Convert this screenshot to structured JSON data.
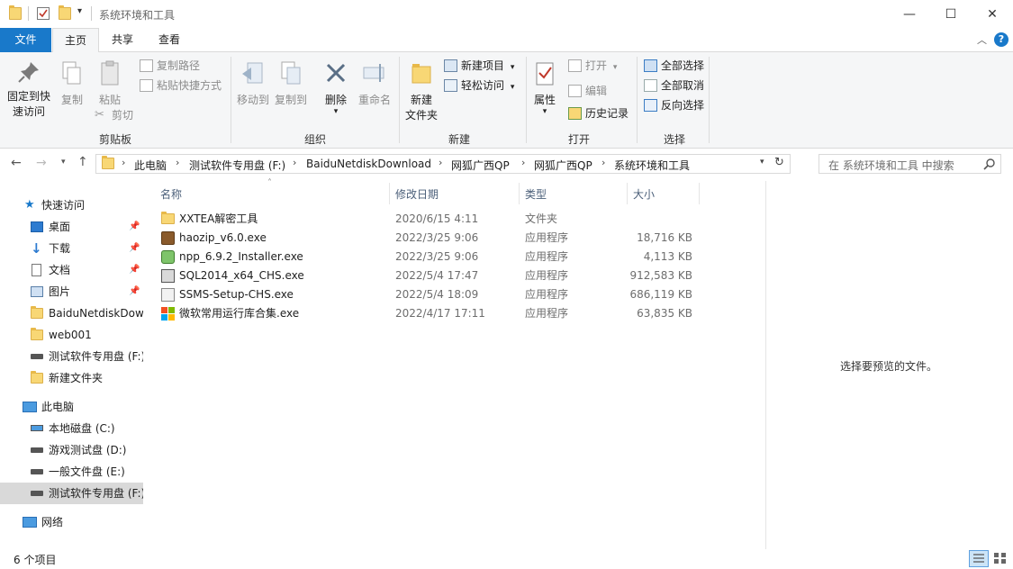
{
  "window": {
    "title": "系统环境和工具",
    "minimize_glyph": "—",
    "maximize_glyph": "☐",
    "close_glyph": "✕"
  },
  "tabs": {
    "file": "文件",
    "home": "主页",
    "share": "共享",
    "view": "查看"
  },
  "ribbon": {
    "clipboard": {
      "label": "剪贴板",
      "pin": "固定到快速访问",
      "pin_line1": "固定到快",
      "pin_line2": "速访问",
      "copy": "复制",
      "paste": "粘贴",
      "copy_path": "复制路径",
      "paste_shortcut": "粘贴快捷方式",
      "cut": "剪切"
    },
    "organize": {
      "label": "组织",
      "move_to": "移动到",
      "copy_to": "复制到",
      "delete": "删除",
      "rename": "重命名"
    },
    "new": {
      "label": "新建",
      "new_folder_line1": "新建",
      "new_folder_line2": "文件夹",
      "new_item": "新建项目",
      "easy_access": "轻松访问"
    },
    "open": {
      "label": "打开",
      "properties": "属性",
      "open": "打开",
      "edit": "编辑",
      "history": "历史记录"
    },
    "select": {
      "label": "选择",
      "select_all": "全部选择",
      "select_none": "全部取消",
      "invert": "反向选择"
    }
  },
  "address": {
    "crumbs": [
      "此电脑",
      "测试软件专用盘 (F:)",
      "BaiduNetdiskDownload",
      "网狐广西QP",
      "网狐广西QP",
      "系统环境和工具"
    ],
    "search_placeholder": "在 系统环境和工具 中搜索"
  },
  "nav": {
    "quick_access": "快速访问",
    "pinned": [
      {
        "label": "桌面",
        "icon": "desktop-icon"
      },
      {
        "label": "下载",
        "icon": "download-icon"
      },
      {
        "label": "文档",
        "icon": "document-icon"
      },
      {
        "label": "图片",
        "icon": "picture-icon"
      }
    ],
    "recent": [
      "BaiduNetdiskDow",
      "web001",
      "测试软件专用盘 (F:)",
      "新建文件夹"
    ],
    "this_pc": "此电脑",
    "drives": [
      "本地磁盘 (C:)",
      "游戏测试盘 (D:)",
      "一般文件盘 (E:)",
      "测试软件专用盘 (F:)"
    ],
    "network": "网络"
  },
  "columns": {
    "name": "名称",
    "date": "修改日期",
    "type": "类型",
    "size": "大小"
  },
  "files": [
    {
      "name": "XXTEA解密工具",
      "date": "2020/6/15 4:11",
      "type": "文件夹",
      "size": "",
      "icon": "folder-icon"
    },
    {
      "name": "haozip_v6.0.exe",
      "date": "2022/3/25 9:06",
      "type": "应用程序",
      "size": "18,716 KB",
      "icon": "archive-exe-icon"
    },
    {
      "name": "npp_6.9.2_Installer.exe",
      "date": "2022/3/25 9:06",
      "type": "应用程序",
      "size": "4,113 KB",
      "icon": "notepadpp-icon"
    },
    {
      "name": "SQL2014_x64_CHS.exe",
      "date": "2022/5/4 17:47",
      "type": "应用程序",
      "size": "912,583 KB",
      "icon": "installer-icon"
    },
    {
      "name": "SSMS-Setup-CHS.exe",
      "date": "2022/5/4 18:09",
      "type": "应用程序",
      "size": "686,119 KB",
      "icon": "setup-icon"
    },
    {
      "name": "微软常用运行库合集.exe",
      "date": "2022/4/17 17:11",
      "type": "应用程序",
      "size": "63,835 KB",
      "icon": "windows-logo-icon"
    }
  ],
  "preview": {
    "empty_text": "选择要预览的文件。"
  },
  "status": {
    "count": "6 个项目"
  },
  "colors": {
    "accent": "#1979ca",
    "ribbon_bg": "#f5f6f7",
    "folder": "#f8d775",
    "header_text": "#4c607a"
  }
}
